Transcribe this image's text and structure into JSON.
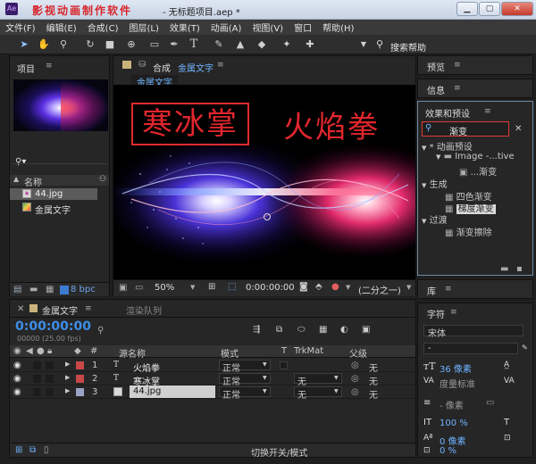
{
  "watermark": "影视动画制作软件",
  "window": {
    "title": "- 无标题项目.aep *"
  },
  "menu": [
    "文件(F)",
    "编辑(E)",
    "合成(C)",
    "图层(L)",
    "效果(T)",
    "动画(A)",
    "视图(V)",
    "窗口",
    "帮助(H)"
  ],
  "toolbar": {
    "search_help": "搜索帮助"
  },
  "project": {
    "tab": "项目",
    "menu": "≡",
    "col_name": "名称",
    "items": [
      {
        "name": "44.jpg",
        "selected": true
      },
      {
        "name": "金属文字",
        "selected": false
      }
    ],
    "bpc": "8 bpc"
  },
  "comp": {
    "tab_label": "合成",
    "tab_name": "金属文字",
    "sub_tab": "金属文字",
    "title_left": "寒冰掌",
    "title_right": "火焰拳",
    "zoom": "50%",
    "timecode": "0:00:00:00",
    "resolution": "(二分之一)"
  },
  "right": {
    "preview": "预览",
    "info": "信息",
    "effects_title": "效果和预设",
    "search_value": "渐变",
    "tree": [
      {
        "label": "* 动画预设",
        "level": 0
      },
      {
        "label": "Image -...tive",
        "level": 1
      },
      {
        "label": "...渐变",
        "level": 2
      },
      {
        "label": "生成",
        "level": 0
      },
      {
        "label": "四色渐变",
        "level": 1
      },
      {
        "label": "梯度渐变",
        "level": 1,
        "selected": true
      },
      {
        "label": "过渡",
        "level": 0
      },
      {
        "label": "渐变擦除",
        "level": 1
      }
    ],
    "library": "库",
    "character": "字符"
  },
  "timeline": {
    "tab": "金属文字",
    "render_tab": "渲染队列",
    "time": "0:00:00:00",
    "frames": "00000 (25.00 fps)",
    "col_num": "#",
    "col_source": "源名称",
    "col_mode": "模式",
    "col_t": "T",
    "col_trkmat": "TrkMat",
    "col_parent": "父级",
    "layers": [
      {
        "num": "1",
        "name": "火焰拳",
        "mode": "正常",
        "trkmat": "",
        "parent": "无",
        "color": "#c84848"
      },
      {
        "num": "2",
        "name": "寒冰掌",
        "mode": "正常",
        "trkmat": "无",
        "parent": "无",
        "color": "#c84848"
      },
      {
        "num": "3",
        "name": "44.jpg",
        "mode": "正常",
        "trkmat": "无",
        "parent": "无",
        "color": "#9aa3c4"
      }
    ],
    "footer": "切换开关/模式"
  },
  "character": {
    "font": "宋体",
    "style": "-",
    "size": "36 像素",
    "leading": "度量标准",
    "kerning_unit": "- 像素",
    "vscale": "100 %",
    "baseline": "0 像素",
    "tsume": "0 %",
    "size_unit": "像素"
  }
}
